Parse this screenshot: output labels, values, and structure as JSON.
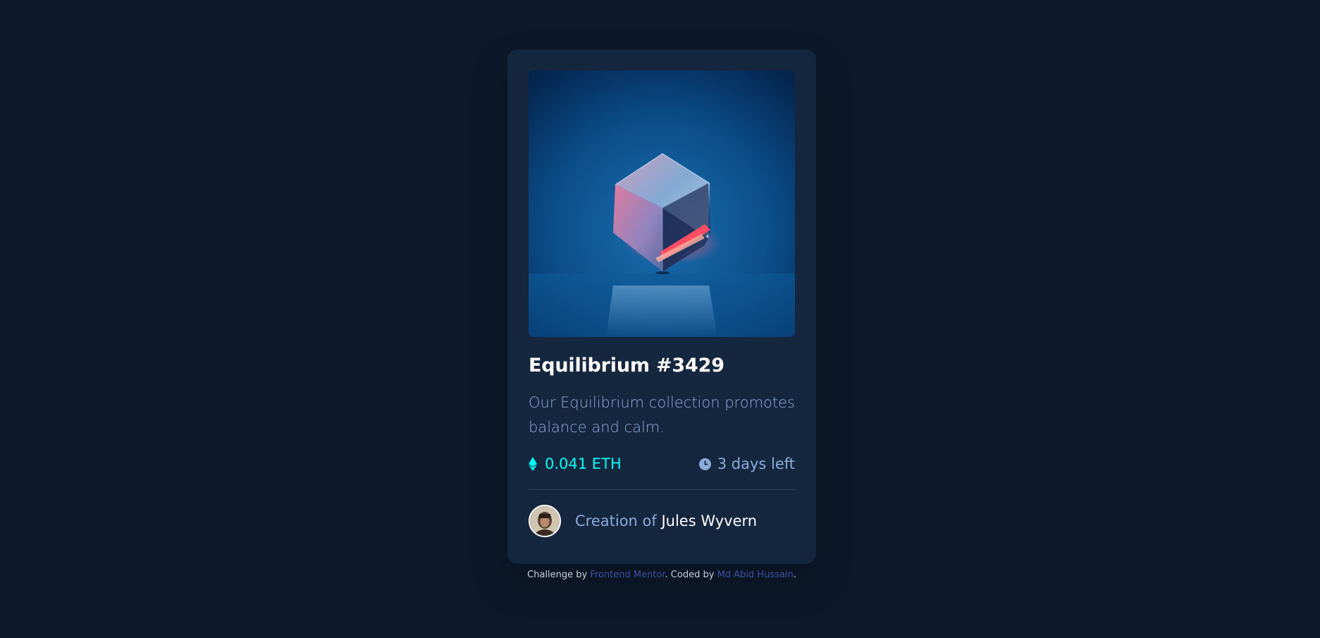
{
  "card": {
    "title": "Equilibrium #3429",
    "description": "Our Equilibrium collection promotes balance and calm.",
    "price": "0.041 ETH",
    "price_icon": "ethereum-icon",
    "time_left": "3 days left",
    "time_icon": "clock-icon",
    "creator_prefix": "Creation of ",
    "creator_name": "Jules Wyvern"
  },
  "attribution": {
    "prefix": "Challenge by ",
    "link1": "Frontend Mentor",
    "middle": ". Coded by ",
    "link2": "Md Abid Hussain",
    "suffix": "."
  },
  "colors": {
    "background": "#0d192b",
    "card": "#15263f",
    "accent_cyan": "#00fff8",
    "soft_blue": "#8bacd9",
    "link_blue": "#3e52a3"
  }
}
